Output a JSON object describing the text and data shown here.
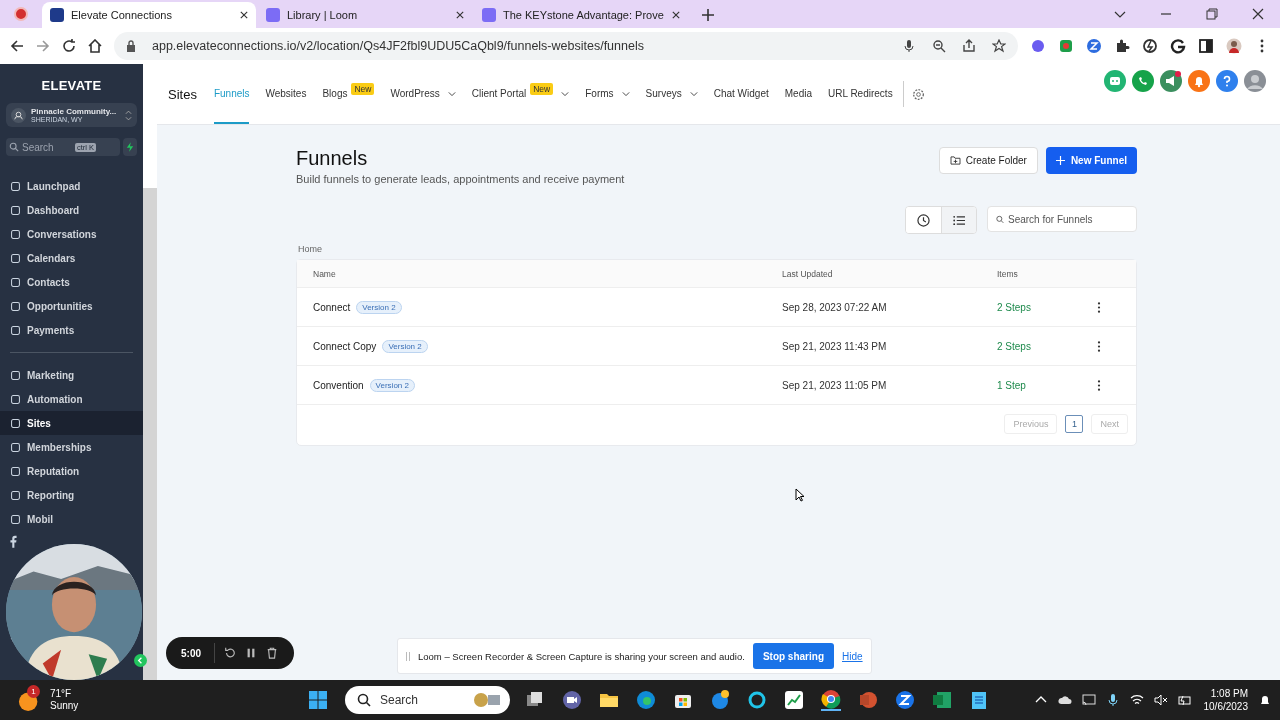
{
  "browser": {
    "tabs": [
      {
        "title": "Elevate Connections",
        "selected": true
      },
      {
        "title": "Library | Loom",
        "selected": false
      },
      {
        "title": "The KEYstone Advantage: Prove",
        "selected": false
      }
    ],
    "url": "app.elevateconnections.io/v2/location/Qs4JF2fbl9UDU5CaQbl9/funnels-websites/funnels"
  },
  "sidebar": {
    "brand": "ELEVATE",
    "account": {
      "name": "Pinnacle Community...",
      "location": "SHERIDAN, WY"
    },
    "search": {
      "placeholder": "Search",
      "shortcut": "ctrl K"
    },
    "groups": [
      [
        {
          "label": "Launchpad",
          "selected": false
        },
        {
          "label": "Dashboard",
          "selected": false
        },
        {
          "label": "Conversations",
          "selected": false
        },
        {
          "label": "Calendars",
          "selected": false
        },
        {
          "label": "Contacts",
          "selected": false
        },
        {
          "label": "Opportunities",
          "selected": false
        },
        {
          "label": "Payments",
          "selected": false
        }
      ],
      [
        {
          "label": "Marketing",
          "selected": false
        },
        {
          "label": "Automation",
          "selected": false
        },
        {
          "label": "Sites",
          "selected": true
        },
        {
          "label": "Memberships",
          "selected": false
        },
        {
          "label": "Reputation",
          "selected": false
        },
        {
          "label": "Reporting",
          "selected": false
        },
        {
          "label": "Mobil",
          "selected": false
        }
      ]
    ]
  },
  "topnav": {
    "section": "Sites",
    "tabs": [
      {
        "label": "Funnels",
        "selected": true,
        "has_menu": false
      },
      {
        "label": "Websites",
        "selected": false,
        "has_menu": false
      },
      {
        "label": "Blogs",
        "selected": false,
        "has_menu": false,
        "badge": "New"
      },
      {
        "label": "WordPress",
        "selected": false,
        "has_menu": true
      },
      {
        "label": "Client Portal",
        "selected": false,
        "has_menu": true,
        "badge": "New"
      },
      {
        "label": "Forms",
        "selected": false,
        "has_menu": true
      },
      {
        "label": "Surveys",
        "selected": false,
        "has_menu": true
      },
      {
        "label": "Chat Widget",
        "selected": false,
        "has_menu": false
      },
      {
        "label": "Media",
        "selected": false,
        "has_menu": false
      },
      {
        "label": "URL Redirects",
        "selected": false,
        "has_menu": false
      }
    ]
  },
  "page": {
    "title": "Funnels",
    "subtitle": "Build funnels to generate leads, appointments and receive payment",
    "create_folder": "Create Folder",
    "new_funnel": "New Funnel",
    "views": [
      {
        "selected": false
      },
      {
        "selected": true
      }
    ],
    "search": {
      "placeholder": "Search for Funnels"
    },
    "breadcrumb": "Home",
    "table": {
      "columns": [
        "Name",
        "Last Updated",
        "Items"
      ],
      "rows": [
        {
          "name": "Connect",
          "badge": "Version 2",
          "updated": "Sep 28, 2023 07:22 AM",
          "items": "2 Steps"
        },
        {
          "name": "Connect Copy",
          "badge": "Version 2",
          "updated": "Sep 21, 2023 11:43 PM",
          "items": "2 Steps"
        },
        {
          "name": "Convention",
          "badge": "Version 2",
          "updated": "Sep 21, 2023 11:05 PM",
          "items": "1 Step"
        }
      ]
    },
    "pagination": {
      "previous": "Previous",
      "pages": [
        {
          "label": "1",
          "selected": true
        }
      ],
      "next": "Next"
    }
  },
  "recorder": {
    "time": "5:00"
  },
  "loom_bar": {
    "message": "Loom – Screen Recorder & Screen Capture is sharing your screen and audio.",
    "stop": "Stop sharing",
    "hide": "Hide"
  },
  "taskbar": {
    "badge": "1",
    "temperature": "71°F",
    "condition": "Sunny",
    "search": "Search",
    "time": "1:08 PM",
    "date": "10/6/2023"
  }
}
